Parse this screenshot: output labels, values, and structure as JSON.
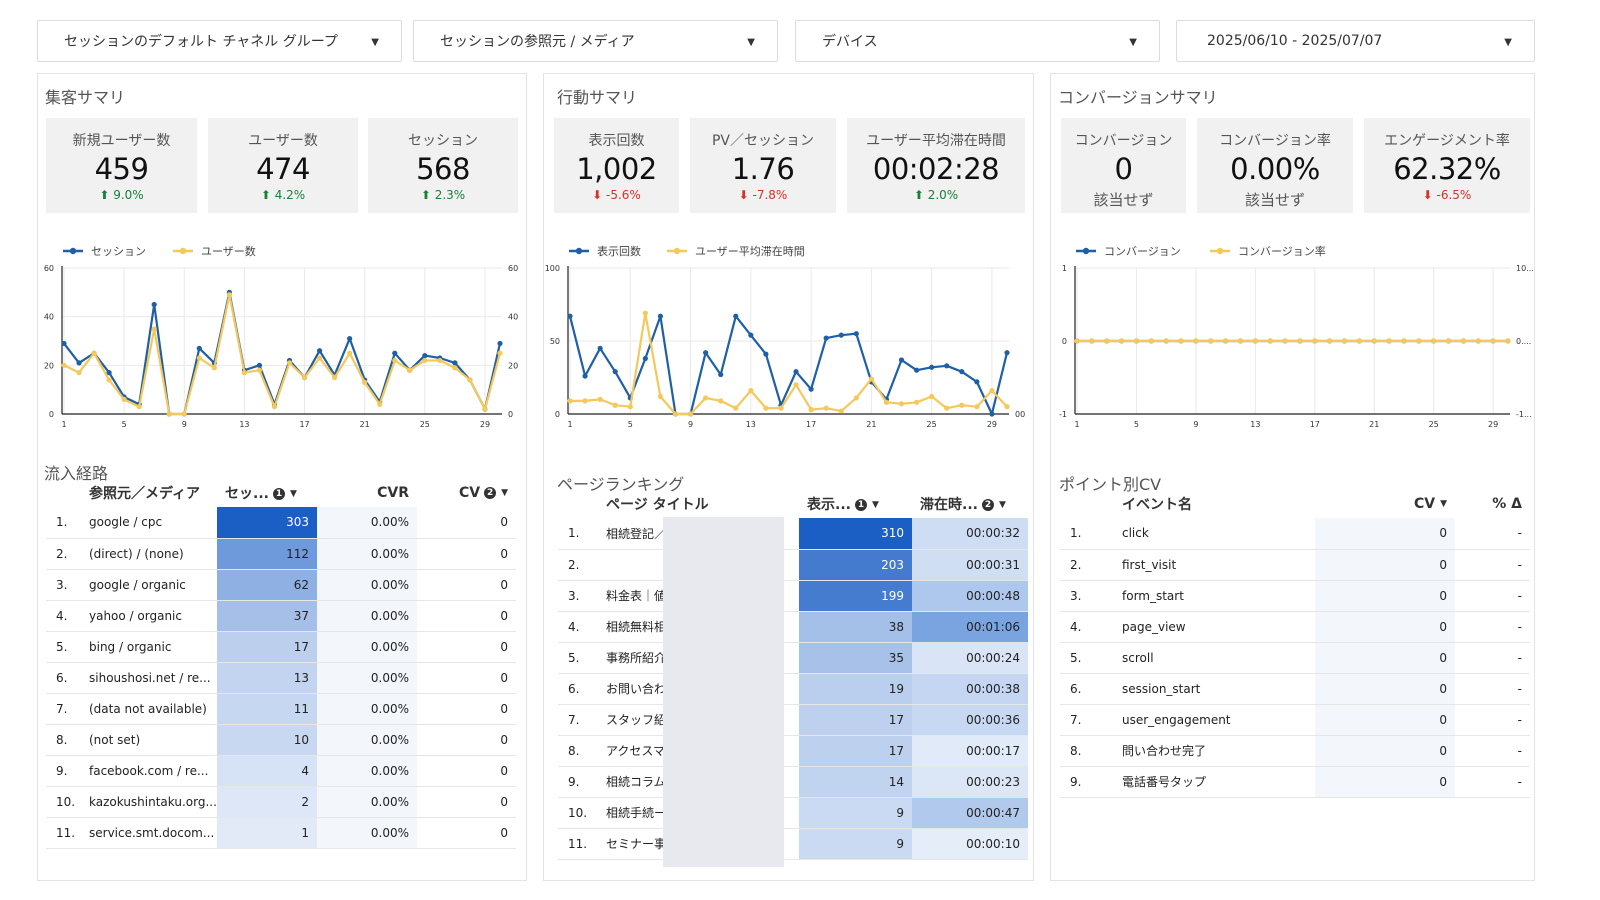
{
  "filters": [
    {
      "label": "セッションのデフォルト チャネル グループ"
    },
    {
      "label": "セッションの参照元 / メディア"
    },
    {
      "label": "デバイス"
    },
    {
      "label": "2025/06/10 - 2025/07/07"
    }
  ],
  "acq": {
    "title": "集客サマリ",
    "kpis": [
      {
        "label": "新規ユーザー数",
        "value": "459",
        "delta": "9.0%",
        "dir": "up"
      },
      {
        "label": "ユーザー数",
        "value": "474",
        "delta": "4.2%",
        "dir": "up"
      },
      {
        "label": "セッション",
        "value": "568",
        "delta": "2.3%",
        "dir": "up"
      }
    ]
  },
  "beh": {
    "title": "行動サマリ",
    "kpis": [
      {
        "label": "表示回数",
        "value": "1,002",
        "delta": "-5.6%",
        "dir": "dn"
      },
      {
        "label": "PV／セッション",
        "value": "1.76",
        "delta": "-7.8%",
        "dir": "dn"
      },
      {
        "label": "ユーザー平均滞在時間",
        "value": "00:02:28",
        "delta": "2.0%",
        "dir": "up"
      }
    ]
  },
  "conv": {
    "title": "コンバージョンサマリ",
    "kpis": [
      {
        "label": "コンバージョン",
        "value": "0",
        "sub": "該当せず"
      },
      {
        "label": "コンバージョン率",
        "value": "0.00%",
        "sub": "該当せず"
      },
      {
        "label": "エンゲージメント率",
        "value": "62.32%",
        "delta": "-6.5%",
        "dir": "dn"
      }
    ]
  },
  "colors": {
    "blue": "#1f5fa6",
    "yellow": "#f4c85a",
    "up": "#188038",
    "down": "#d93025"
  },
  "chart_data": [
    {
      "type": "line",
      "x": [
        1,
        2,
        3,
        4,
        5,
        6,
        7,
        8,
        9,
        10,
        11,
        12,
        13,
        14,
        15,
        16,
        17,
        18,
        19,
        20,
        21,
        22,
        23,
        24,
        25,
        26,
        27,
        28,
        29,
        30
      ],
      "x_ticks": [
        "1",
        "5",
        "9",
        "13",
        "17",
        "21",
        "25",
        "29"
      ],
      "y_ticks_left": [
        "0",
        "20",
        "40",
        "60"
      ],
      "y_ticks_right": [
        "0",
        "20",
        "40",
        "60"
      ],
      "ylim": [
        0,
        60
      ],
      "y2lim": [
        0,
        60
      ],
      "series": [
        {
          "name": "セッション",
          "axis": "left",
          "values": [
            29,
            21,
            25,
            17,
            7,
            4,
            45,
            0,
            0,
            27,
            21,
            50,
            18,
            20,
            4,
            22,
            15,
            26,
            16,
            31,
            14,
            5,
            25,
            18,
            24,
            23,
            21,
            14,
            2,
            29
          ]
        },
        {
          "name": "ユーザー数",
          "axis": "right",
          "values": [
            20,
            17,
            25,
            14,
            6,
            3,
            35,
            0,
            0,
            23,
            19,
            49,
            17,
            18,
            3,
            21,
            15,
            23,
            15,
            25,
            13,
            4,
            22,
            18,
            22,
            22,
            19,
            14,
            2,
            25
          ]
        }
      ]
    },
    {
      "type": "line",
      "x": [
        1,
        2,
        3,
        4,
        5,
        6,
        7,
        8,
        9,
        10,
        11,
        12,
        13,
        14,
        15,
        16,
        17,
        18,
        19,
        20,
        21,
        22,
        23,
        24,
        25,
        26,
        27,
        28,
        29,
        30
      ],
      "x_ticks": [
        "1",
        "5",
        "9",
        "13",
        "17",
        "21",
        "25",
        "29"
      ],
      "y_ticks_left": [
        "0",
        "50",
        "100"
      ],
      "y_ticks_right": [
        "00"
      ],
      "ylim": [
        0,
        100
      ],
      "y2lim": [
        0,
        100
      ],
      "series": [
        {
          "name": "表示回数",
          "axis": "left",
          "values": [
            67,
            26,
            45,
            29,
            11,
            38,
            67,
            0,
            0,
            42,
            27,
            67,
            54,
            41,
            6,
            29,
            17,
            52,
            54,
            55,
            22,
            10,
            37,
            30,
            32,
            33,
            29,
            22,
            0,
            42
          ]
        },
        {
          "name": "ユーザー平均滞在時間",
          "axis": "right",
          "values": [
            9,
            9,
            10,
            6,
            5,
            69,
            12,
            0,
            0,
            11,
            9,
            4,
            16,
            4,
            4,
            20,
            3,
            4,
            2,
            11,
            24,
            8,
            7,
            8,
            12,
            4,
            6,
            5,
            16,
            5
          ]
        }
      ]
    },
    {
      "type": "line",
      "x": [
        1,
        2,
        3,
        4,
        5,
        6,
        7,
        8,
        9,
        10,
        11,
        12,
        13,
        14,
        15,
        16,
        17,
        18,
        19,
        20,
        21,
        22,
        23,
        24,
        25,
        26,
        27,
        28,
        29,
        30
      ],
      "x_ticks": [
        "1",
        "5",
        "9",
        "13",
        "17",
        "21",
        "25",
        "29"
      ],
      "y_ticks_left": [
        "-1",
        "0",
        "1"
      ],
      "y_ticks_right": [
        "-1...",
        "0....",
        "10..."
      ],
      "ylim": [
        -1,
        1
      ],
      "y2lim": [
        -1,
        1
      ],
      "series": [
        {
          "name": "コンバージョン",
          "axis": "left",
          "values": [
            0,
            0,
            0,
            0,
            0,
            0,
            0,
            0,
            0,
            0,
            0,
            0,
            0,
            0,
            0,
            0,
            0,
            0,
            0,
            0,
            0,
            0,
            0,
            0,
            0,
            0,
            0,
            0,
            0,
            0
          ]
        },
        {
          "name": "コンバージョン率",
          "axis": "right",
          "values": [
            0,
            0,
            0,
            0,
            0,
            0,
            0,
            0,
            0,
            0,
            0,
            0,
            0,
            0,
            0,
            0,
            0,
            0,
            0,
            0,
            0,
            0,
            0,
            0,
            0,
            0,
            0,
            0,
            0,
            0
          ]
        }
      ]
    }
  ],
  "traffic": {
    "title": "流入経路",
    "headers": {
      "source": "参照元／メディア",
      "sessions": "セッ...",
      "cvr": "CVR",
      "cv": "CV",
      "info1": "1",
      "info2": "2"
    },
    "rows": [
      {
        "i": "1.",
        "source": "google / cpc",
        "sessions": 303,
        "cvr": "0.00%",
        "cv": "0"
      },
      {
        "i": "2.",
        "source": "(direct) / (none)",
        "sessions": 112,
        "cvr": "0.00%",
        "cv": "0"
      },
      {
        "i": "3.",
        "source": "google / organic",
        "sessions": 62,
        "cvr": "0.00%",
        "cv": "0"
      },
      {
        "i": "4.",
        "source": "yahoo / organic",
        "sessions": 37,
        "cvr": "0.00%",
        "cv": "0"
      },
      {
        "i": "5.",
        "source": "bing / organic",
        "sessions": 17,
        "cvr": "0.00%",
        "cv": "0"
      },
      {
        "i": "6.",
        "source": "sihoushosi.net / re...",
        "sessions": 13,
        "cvr": "0.00%",
        "cv": "0"
      },
      {
        "i": "7.",
        "source": "(data not available)",
        "sessions": 11,
        "cvr": "0.00%",
        "cv": "0"
      },
      {
        "i": "8.",
        "source": "(not set)",
        "sessions": 10,
        "cvr": "0.00%",
        "cv": "0"
      },
      {
        "i": "9.",
        "source": "facebook.com / re...",
        "sessions": 4,
        "cvr": "0.00%",
        "cv": "0"
      },
      {
        "i": "10.",
        "source": "kazokushintaku.org...",
        "sessions": 2,
        "cvr": "0.00%",
        "cv": "0"
      },
      {
        "i": "11.",
        "source": "service.smt.docom...",
        "sessions": 1,
        "cvr": "0.00%",
        "cv": "0"
      }
    ]
  },
  "pages": {
    "title": "ページランキング",
    "headers": {
      "title": "ページ タイトル",
      "views": "表示...",
      "dwell": "滞在時...",
      "info1": "1",
      "info2": "2"
    },
    "rows": [
      {
        "i": "1.",
        "title": "相続登記／",
        "views": 310,
        "dwell": "00:00:32",
        "dsec": 32
      },
      {
        "i": "2.",
        "title": "",
        "views": 203,
        "dwell": "00:00:31",
        "dsec": 31
      },
      {
        "i": "3.",
        "title": "料金表｜値",
        "views": 199,
        "dwell": "00:00:48",
        "dsec": 48
      },
      {
        "i": "4.",
        "title": "相続無料相",
        "views": 38,
        "dwell": "00:01:06",
        "dsec": 66
      },
      {
        "i": "5.",
        "title": "事務所紹介",
        "views": 35,
        "dwell": "00:00:24",
        "dsec": 24
      },
      {
        "i": "6.",
        "title": "お問い合わ",
        "views": 19,
        "dwell": "00:00:38",
        "dsec": 38
      },
      {
        "i": "7.",
        "title": "スタッフ紹",
        "views": 17,
        "dwell": "00:00:36",
        "dsec": 36
      },
      {
        "i": "8.",
        "title": "アクセスマ",
        "views": 17,
        "dwell": "00:00:17",
        "dsec": 17
      },
      {
        "i": "9.",
        "title": "相続コラム",
        "views": 14,
        "dwell": "00:00:23",
        "dsec": 23
      },
      {
        "i": "10.",
        "title": "相続手続ー",
        "views": 9,
        "dwell": "00:00:47",
        "dsec": 47
      },
      {
        "i": "11.",
        "title": "セミナー事",
        "views": 9,
        "dwell": "00:00:10",
        "dsec": 10
      }
    ]
  },
  "events": {
    "title": "ポイント別CV",
    "headers": {
      "name": "イベント名",
      "cv": "CV",
      "pct": "% Δ"
    },
    "rows": [
      {
        "i": "1.",
        "name": "click",
        "cv": "0",
        "pct": "-"
      },
      {
        "i": "2.",
        "name": "first_visit",
        "cv": "0",
        "pct": "-"
      },
      {
        "i": "3.",
        "name": "form_start",
        "cv": "0",
        "pct": "-"
      },
      {
        "i": "4.",
        "name": "page_view",
        "cv": "0",
        "pct": "-"
      },
      {
        "i": "5.",
        "name": "scroll",
        "cv": "0",
        "pct": "-"
      },
      {
        "i": "6.",
        "name": "session_start",
        "cv": "0",
        "pct": "-"
      },
      {
        "i": "7.",
        "name": "user_engagement",
        "cv": "0",
        "pct": "-"
      },
      {
        "i": "8.",
        "name": "問い合わせ完了",
        "cv": "0",
        "pct": "-"
      },
      {
        "i": "9.",
        "name": "電話番号タップ",
        "cv": "0",
        "pct": "-"
      }
    ]
  }
}
